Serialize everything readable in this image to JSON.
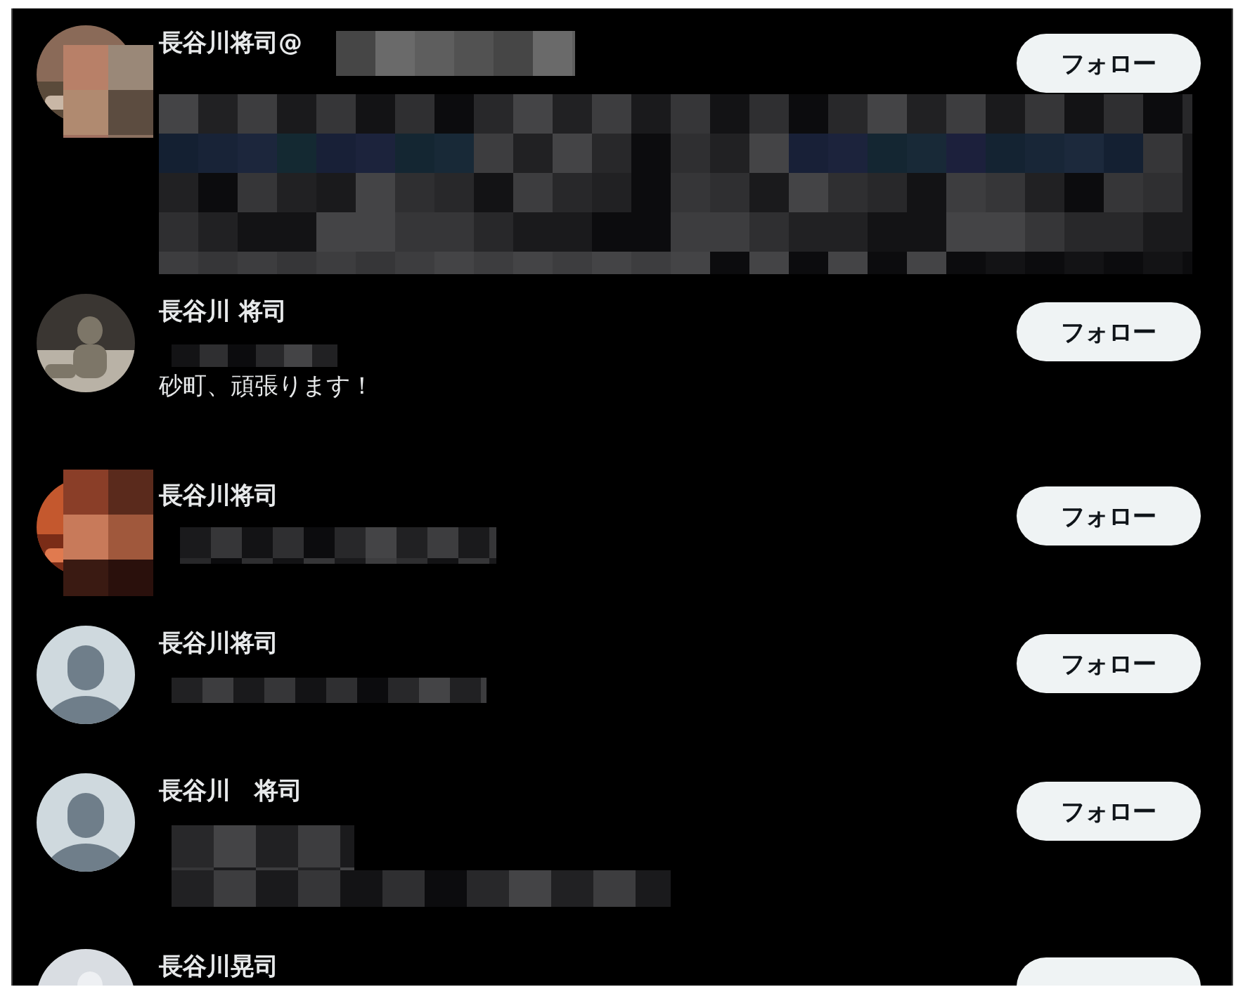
{
  "users": [
    {
      "name": "長谷川将司@",
      "button": "フォロー"
    },
    {
      "name": "長谷川 将司",
      "bio": "砂町、頑張ります！",
      "button": "フォロー"
    },
    {
      "name": "長谷川将司",
      "button": "フォロー"
    },
    {
      "name": "長谷川将司",
      "avatar": {
        "kind": "default"
      },
      "button": "フォロー"
    },
    {
      "name": "長谷川　将司",
      "avatar": {
        "kind": "default"
      },
      "button": "フォロー"
    },
    {
      "name": "長谷川晃司"
    }
  ]
}
